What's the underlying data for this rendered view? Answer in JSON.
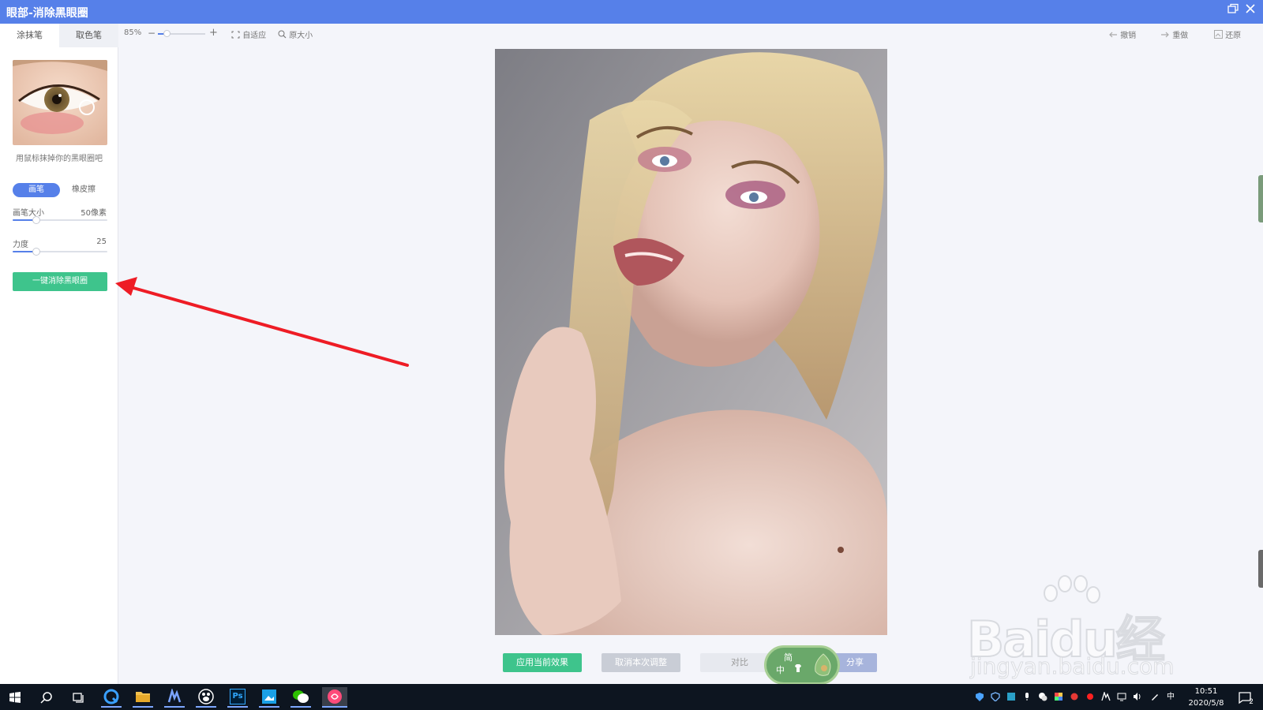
{
  "window": {
    "title": "眼部-消除黑眼圈",
    "restore_icon": "restore-icon",
    "close_icon": "close-icon"
  },
  "left_panel": {
    "tabs": [
      {
        "label": "涂抹笔",
        "active": true
      },
      {
        "label": "取色笔",
        "active": false
      }
    ],
    "hint": "用鼠标抹掉你的黑眼圈吧",
    "modes": [
      {
        "label": "画笔",
        "active": true
      },
      {
        "label": "橡皮擦",
        "active": false
      }
    ],
    "brush_size": {
      "label": "画笔大小",
      "value_text": "50像素",
      "level": 0.25
    },
    "strength": {
      "label": "力度",
      "value_text": "25",
      "level": 0.25
    },
    "one_click_button": "一键消除黑眼圈"
  },
  "toolbar": {
    "zoom_text": "85%",
    "zoom_level": 0.2,
    "zoom_out": "−",
    "zoom_in": "+",
    "fit_label": "自适应",
    "original_size_label": "原大小",
    "undo_label": "撤销",
    "redo_label": "重做",
    "restore_label": "还原"
  },
  "bottom_buttons": {
    "apply": "应用当前效果",
    "cancel": "取消本次调整",
    "compare": "对比",
    "share": "分享"
  },
  "ime_badge": {
    "top_char": "简",
    "bottom_char": "中"
  },
  "watermark": {
    "brand": "Bai",
    "brand_rest": "du",
    "cn": "经验",
    "url": "jingyan.baidu.com"
  },
  "taskbar": {
    "time": "10:51",
    "date": "2020/5/8",
    "ime_indicator": "中",
    "notifications_count": "2",
    "ps_label": "Ps"
  },
  "colors": {
    "accent": "#5680e9",
    "green": "#3ec48c",
    "annotation_red": "#ee1c25"
  }
}
